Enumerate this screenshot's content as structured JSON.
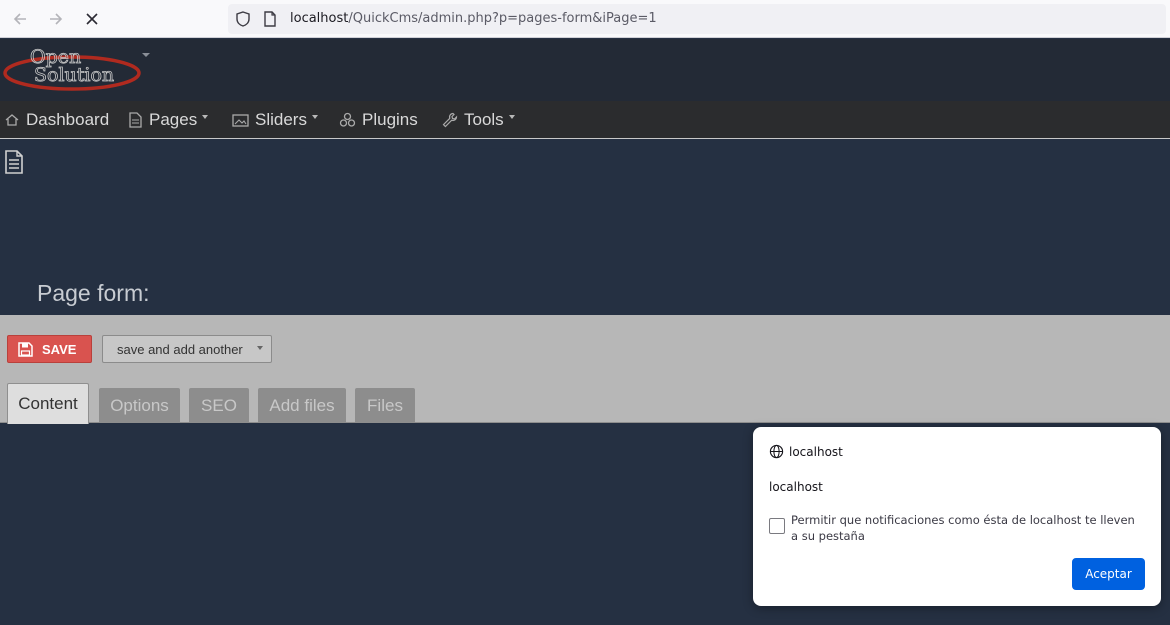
{
  "browser": {
    "url_host": "localhost",
    "url_path": "/QuickCms/admin.php?p=pages-form&iPage=1"
  },
  "header": {
    "logo_line1": "Open",
    "logo_line2": "Solution"
  },
  "menu": {
    "items": [
      {
        "label": "Dashboard",
        "icon": "home-icon"
      },
      {
        "label": "Pages",
        "icon": "document-icon",
        "dropdown": true
      },
      {
        "label": "Sliders",
        "icon": "image-icon",
        "dropdown": true
      },
      {
        "label": "Plugins",
        "icon": "puzzle-icon"
      },
      {
        "label": "Tools",
        "icon": "wrench-icon",
        "dropdown": true
      }
    ]
  },
  "page": {
    "title": "Page form:"
  },
  "form": {
    "save_label": "SAVE",
    "save_another_label": "save and add another",
    "tabs": [
      {
        "label": "Content",
        "active": true
      },
      {
        "label": "Options"
      },
      {
        "label": "SEO"
      },
      {
        "label": "Add files"
      },
      {
        "label": "Files"
      }
    ]
  },
  "notification": {
    "origin": "localhost",
    "body": "localhost",
    "checkbox_label": "Permitir que notificaciones como ésta de localhost te lleven a su pestaña",
    "checkbox_checked": false,
    "accept_label": "Aceptar"
  },
  "colors": {
    "save_button": "#d9534f",
    "accept_button": "#0061e0",
    "page_background": "#253042"
  }
}
